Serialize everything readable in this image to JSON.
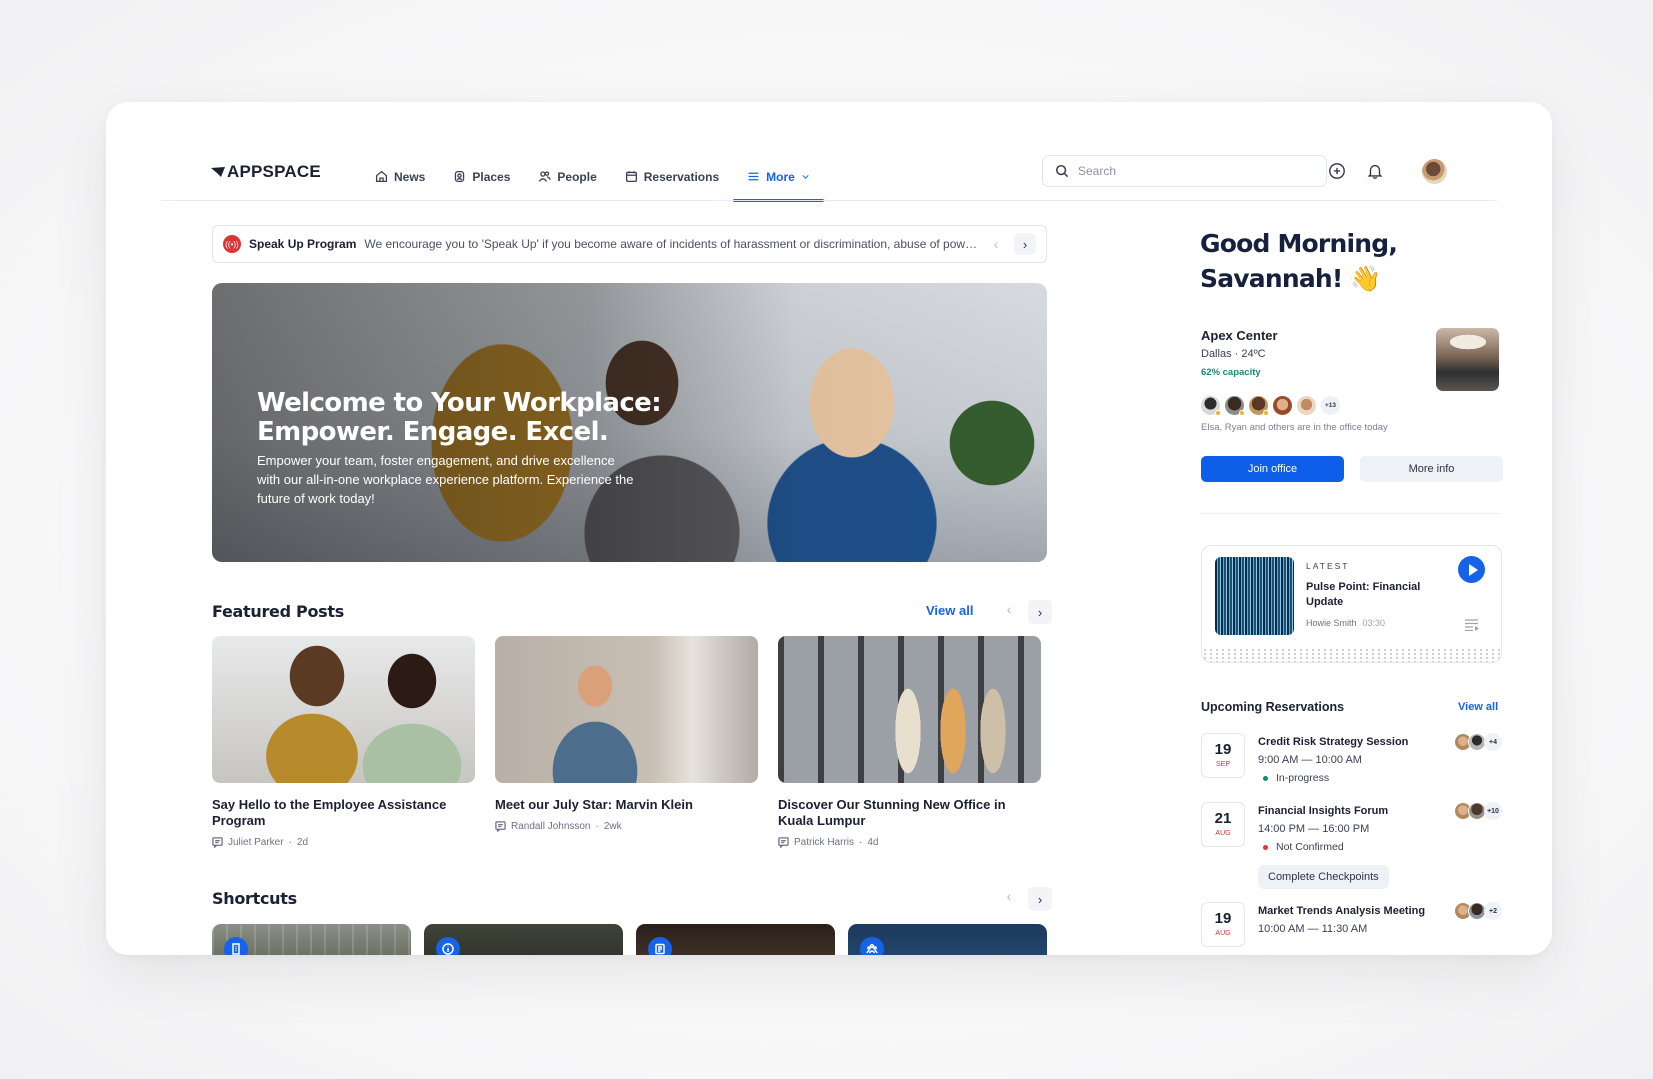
{
  "header": {
    "logo": "APPSPACE",
    "nav": [
      {
        "label": "News",
        "icon": "home-icon"
      },
      {
        "label": "Places",
        "icon": "places-icon"
      },
      {
        "label": "People",
        "icon": "people-icon"
      },
      {
        "label": "Reservations",
        "icon": "calendar-icon"
      },
      {
        "label": "More",
        "icon": "menu-icon",
        "active": true
      }
    ],
    "search_placeholder": "Search"
  },
  "banner": {
    "title": "Speak Up Program",
    "message": "We encourage you to 'Speak Up' if you become aware of incidents of harassment or discrimination, abuse of power, or other misconduct in the workplace."
  },
  "hero": {
    "title": "Welcome to Your Workplace: Empower. Engage. Excel.",
    "body": "Empower your team, foster engagement, and drive excellence with our all-in-one workplace experience platform. Experience the future of work today!"
  },
  "featured": {
    "title": "Featured Posts",
    "view_all": "View all",
    "posts": [
      {
        "title": "Say Hello to the Employee Assistance Program",
        "author": "Juliet Parker",
        "age": "2d"
      },
      {
        "title": "Meet our July Star: Marvin Klein",
        "author": "Randall Johnsson",
        "age": "2wk"
      },
      {
        "title": "Discover Our Stunning New Office in Kuala Lumpur",
        "author": "Patrick Harris",
        "age": "4d"
      }
    ]
  },
  "shortcuts": {
    "title": "Shortcuts",
    "items": [
      {
        "icon": "building-icon"
      },
      {
        "icon": "info-icon"
      },
      {
        "icon": "newspaper-icon"
      },
      {
        "icon": "team-icon"
      }
    ]
  },
  "greeting": {
    "line1": "Good Morning,",
    "line2": "Savannah! 👋"
  },
  "office": {
    "name": "Apex Center",
    "location": "Dallas · 24ºC",
    "capacity": "62% capacity",
    "more_count": "+13",
    "note": "Elsa, Ryan and others are in the office today",
    "join_label": "Join office",
    "more_label": "More info"
  },
  "podcast": {
    "label": "LATEST",
    "title": "Pulse Point: Financial Update",
    "author": "Howie Smith",
    "duration": "03:30"
  },
  "reservations": {
    "title": "Upcoming Reservations",
    "view_all": "View all",
    "items": [
      {
        "day": "19",
        "month": "SEP",
        "name": "Credit Risk Strategy Session",
        "time": "9:00 AM — 10:00 AM",
        "status": "In-progress",
        "status_color": "#138a74",
        "count": "+4"
      },
      {
        "day": "21",
        "month": "AUG",
        "name": "Financial Insights Forum",
        "time": "14:00 PM — 16:00 PM",
        "status": "Not Confirmed",
        "status_color": "#d93636",
        "count": "+10",
        "action": "Complete Checkpoints"
      },
      {
        "day": "19",
        "month": "AUG",
        "name": "Market Trends Analysis Meeting",
        "time": "10:00 AM — 11:30 AM",
        "count": "+2"
      }
    ]
  },
  "colors": {
    "accent": "#1662e8",
    "alert": "#d93636",
    "success": "#1a8a73"
  }
}
